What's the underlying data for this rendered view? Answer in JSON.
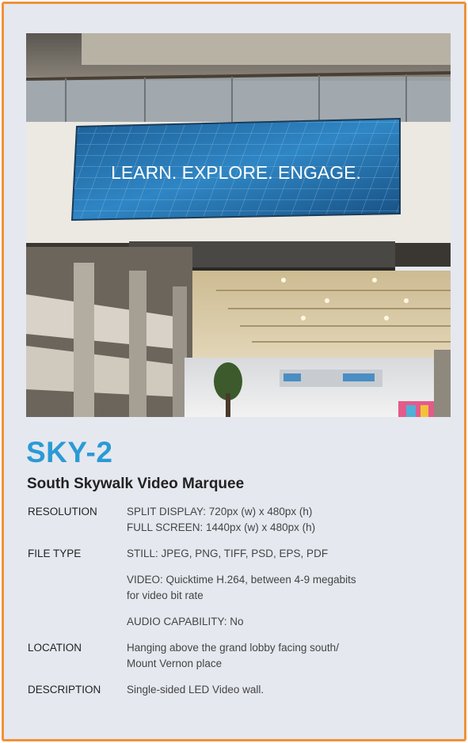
{
  "photo": {
    "screen_text": "LEARN. EXPLORE. ENGAGE."
  },
  "title": {
    "code": "SKY-2",
    "name": "South Skywalk Video Marquee"
  },
  "specs": {
    "resolution": {
      "label": "RESOLUTION",
      "lines": [
        "SPLIT DISPLAY: 720px (w) x 480px (h)",
        "FULL SCREEN: 1440px (w) x 480px (h)"
      ]
    },
    "file_type": {
      "label": "FILE TYPE",
      "still": "STILL: JPEG, PNG, TIFF, PSD, EPS, PDF",
      "video_lines": [
        "VIDEO: Quicktime H.264, between 4-9 megabits",
        "for video bit rate"
      ],
      "audio": "AUDIO CAPABILITY: No"
    },
    "location": {
      "label": "LOCATION",
      "lines": [
        "Hanging above the grand lobby facing south/",
        "Mount Vernon place"
      ]
    },
    "description": {
      "label": "DESCRIPTION",
      "text": "Single-sided LED Video wall."
    }
  },
  "colors": {
    "border": "#f0913a",
    "background": "#e5e8ef",
    "accent": "#2b9ad6",
    "text": "#222222"
  }
}
